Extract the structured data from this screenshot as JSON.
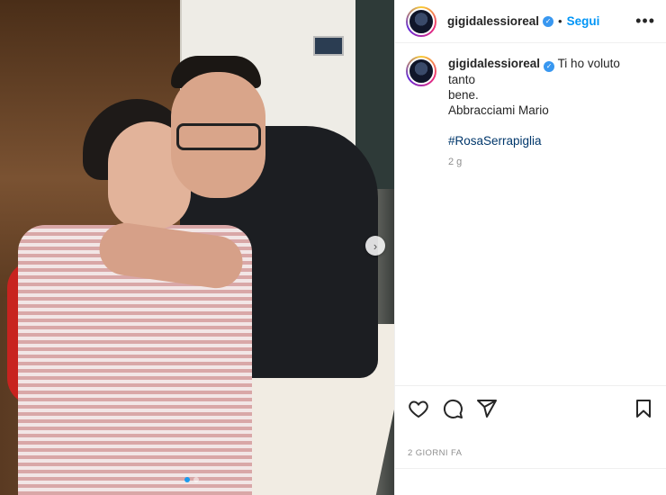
{
  "post": {
    "username": "gigidalessioreal",
    "follow_label": "Segui",
    "separator": "•",
    "caption_lines": [
      "Ti ho voluto tanto",
      "bene.",
      "Abbracciami Mario"
    ],
    "hashtag": "#RosaSerrapiglia",
    "caption_age": "2 g",
    "date": "2 GIORNI FA"
  },
  "carousel": {
    "next_icon": "›",
    "slide_count": 2,
    "active_index": 0
  },
  "icons": [
    "like-icon",
    "comment-icon",
    "share-icon",
    "save-icon",
    "more-options-icon",
    "verified-icon"
  ],
  "colors": {
    "follow": "#0095f6",
    "hashtag": "#00376b",
    "muted": "#8e8e8e"
  }
}
